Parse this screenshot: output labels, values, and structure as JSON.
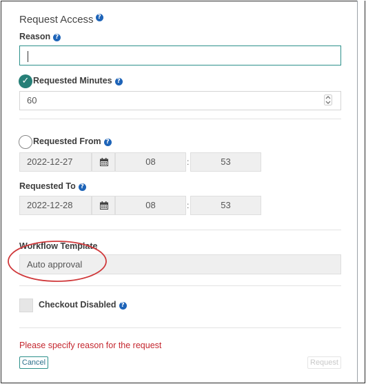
{
  "dialog": {
    "title": "Request Access",
    "help_glyph": "?"
  },
  "reason": {
    "label": "Reason",
    "value": ""
  },
  "requested_minutes": {
    "label": "Requested Minutes",
    "checked": true,
    "check_glyph": "✓",
    "value": "60"
  },
  "requested_from": {
    "label": "Requested From",
    "checked": false,
    "date": "2022-12-27",
    "hour": "08",
    "minute": "53",
    "separator": ":"
  },
  "requested_to": {
    "label": "Requested To",
    "date": "2022-12-28",
    "hour": "08",
    "minute": "53",
    "separator": ":"
  },
  "workflow_template": {
    "label": "Workflow Template",
    "value": "Auto approval",
    "highlight_color": "#d0393b"
  },
  "checkout_disabled": {
    "label": "Checkout Disabled",
    "checked": false
  },
  "error_message": "Please specify reason for the request",
  "buttons": {
    "cancel": "Cancel",
    "request": "Request"
  },
  "icons": {
    "help": "help-circle-icon",
    "calendar": "calendar-icon",
    "check": "check-circle-icon",
    "spinner": "up-down-spinner-icon"
  },
  "colors": {
    "accent": "#267f77",
    "help": "#1e64b8",
    "error": "#c4262e"
  }
}
